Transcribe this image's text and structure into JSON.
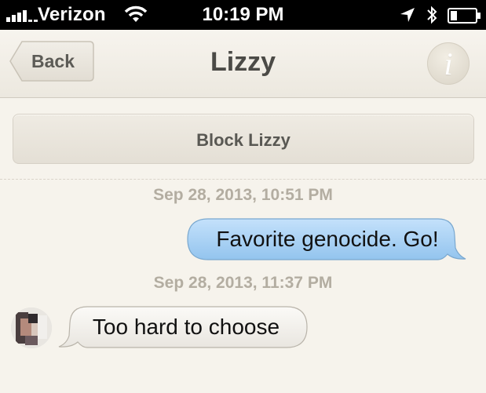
{
  "status_bar": {
    "carrier": "Verizon",
    "time": "10:19 PM",
    "icons": [
      "signal-icon",
      "wifi-icon",
      "location-arrow-icon",
      "bluetooth-icon",
      "battery-icon"
    ]
  },
  "navbar": {
    "back_label": "Back",
    "title": "Lizzy",
    "info_glyph": "i"
  },
  "block_button": {
    "label": "Block Lizzy"
  },
  "messages": [
    {
      "timestamp": "Sep 28, 2013, 10:51 PM",
      "direction": "outgoing",
      "text": "Favorite genocide. Go!"
    },
    {
      "timestamp": "Sep 28, 2013, 11:37 PM",
      "direction": "incoming",
      "text": "Too hard to choose"
    }
  ],
  "colors": {
    "outgoing_bubble": "#a9d2f5",
    "incoming_bubble": "#f4f2ee",
    "background": "#f6f3ec"
  }
}
